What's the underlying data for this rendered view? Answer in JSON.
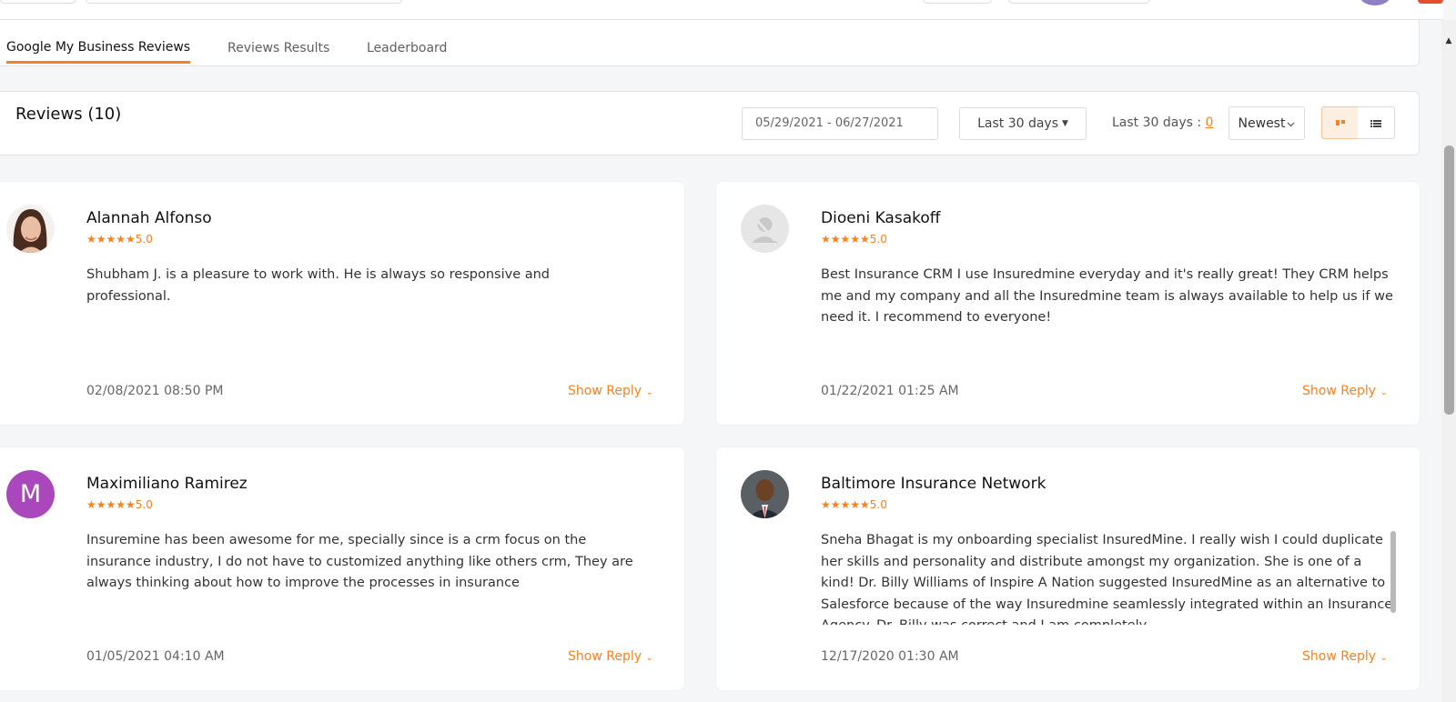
{
  "tabs": [
    {
      "label": "Google My Business Reviews",
      "active": true
    },
    {
      "label": "Reviews Results",
      "active": false
    },
    {
      "label": "Leaderboard",
      "active": false
    }
  ],
  "filters": {
    "title": "Reviews (10)",
    "date_range": "05/29/2021 - 06/27/2021",
    "period": "Last 30 days",
    "count_label": "Last 30 days : ",
    "count_value": "0",
    "sort": "Newest",
    "grid_view_icon": "grid-view-icon",
    "list_view_icon": "list-view-icon"
  },
  "reviews": [
    {
      "name": "Alannah Alfonso",
      "stars": "★★★★★",
      "score": "5.0",
      "text": "Shubham J. is a pleasure to work with. He is always so responsive and professional.",
      "date": "02/08/2021 08:50 PM",
      "reply_label": "Show Reply",
      "avatar": "photo"
    },
    {
      "name": "Dioeni Kasakoff",
      "stars": "★★★★★",
      "score": "5.0",
      "text": "Best Insurance CRM I use Insuredmine everyday and it's really great! They CRM helps me and my company and all the Insuredmine team is always available to help us if we need it. I recommend to everyone!",
      "date": "01/22/2021 01:25 AM",
      "reply_label": "Show Reply",
      "avatar": "no-photo"
    },
    {
      "name": "Maximiliano Ramirez",
      "stars": "★★★★★",
      "score": "5.0",
      "text": "Insuremine has been awesome for me, specially since is a crm focus on the insurance industry, I do not have to customized anything like others crm, They are always thinking about how to improve the processes in insurance",
      "date": "01/05/2021 04:10 AM",
      "reply_label": "Show Reply",
      "avatar_letter": "M"
    },
    {
      "name": "Baltimore Insurance Network",
      "stars": "★★★★★",
      "score": "5.0",
      "text": "Sneha Bhagat is my onboarding specialist InsuredMine. I really wish I could duplicate her skills and personality and distribute amongst my organization. She is one of a kind! Dr. Billy Williams of Inspire A Nation suggested InsuredMine as an alternative to Salesforce because of the way Insuredmine seamlessly integrated within an Insurance Agency. Dr. Billy was correct and I am completely",
      "date": "12/17/2020 01:30 AM",
      "reply_label": "Show Reply",
      "avatar": "photo"
    }
  ],
  "colors": {
    "accent": "#f58220",
    "avatar_m": "#ab47bc",
    "page_bg": "#f5f6f8"
  }
}
